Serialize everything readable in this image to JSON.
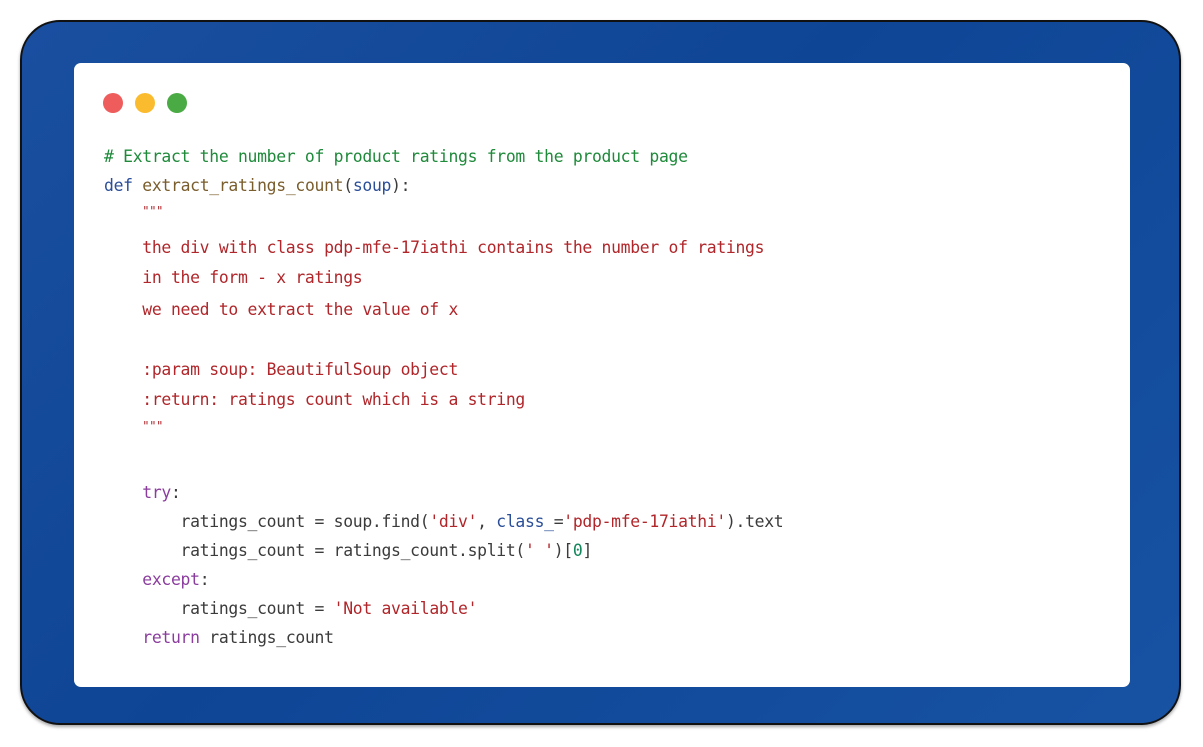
{
  "window": {
    "controls": [
      {
        "name": "close",
        "color": "#ee5c5c"
      },
      {
        "name": "minimize",
        "color": "#fbbb2f"
      },
      {
        "name": "maximize",
        "color": "#4aaa44"
      }
    ]
  },
  "code": {
    "language": "python",
    "lines": [
      {
        "tokens": [
          {
            "t": "# Extract the number of product ratings from the product page",
            "c": "comment"
          }
        ]
      },
      {
        "tokens": [
          {
            "t": "def",
            "c": "kw"
          },
          {
            "t": " ",
            "c": "plain"
          },
          {
            "t": "extract_ratings_count",
            "c": "fn"
          },
          {
            "t": "(",
            "c": "plain"
          },
          {
            "t": "soup",
            "c": "param"
          },
          {
            "t": "):",
            "c": "plain"
          }
        ]
      },
      {
        "tokens": [
          {
            "t": "    ",
            "c": "plain"
          },
          {
            "t": "\"\"\"",
            "c": "str"
          }
        ]
      },
      {
        "tokens": [
          {
            "t": "    the div with class pdp-mfe-17iathi contains the number of ratings",
            "c": "str"
          }
        ]
      },
      {
        "tokens": [
          {
            "t": "    in the form - x ratings",
            "c": "str"
          }
        ]
      },
      {
        "tokens": [
          {
            "t": "    we need to extract the value of x",
            "c": "str"
          }
        ]
      },
      {
        "tokens": []
      },
      {
        "tokens": [
          {
            "t": "    :param soup: BeautifulSoup object",
            "c": "str"
          }
        ]
      },
      {
        "tokens": [
          {
            "t": "    :return: ratings count which is a string",
            "c": "str"
          }
        ]
      },
      {
        "tokens": [
          {
            "t": "    ",
            "c": "plain"
          },
          {
            "t": "\"\"\"",
            "c": "str"
          }
        ]
      },
      {
        "tokens": []
      },
      {
        "tokens": []
      },
      {
        "tokens": [
          {
            "t": "    ",
            "c": "plain"
          },
          {
            "t": "try",
            "c": "ctrl"
          },
          {
            "t": ":",
            "c": "plain"
          }
        ]
      },
      {
        "tokens": [
          {
            "t": "        ratings_count = soup.find(",
            "c": "plain"
          },
          {
            "t": "'div'",
            "c": "str"
          },
          {
            "t": ", ",
            "c": "plain"
          },
          {
            "t": "class_",
            "c": "param"
          },
          {
            "t": "=",
            "c": "plain"
          },
          {
            "t": "'pdp-mfe-17iathi'",
            "c": "str"
          },
          {
            "t": ").text",
            "c": "plain"
          }
        ]
      },
      {
        "tokens": [
          {
            "t": "        ratings_count = ratings_count.split(",
            "c": "plain"
          },
          {
            "t": "' '",
            "c": "str"
          },
          {
            "t": ")[",
            "c": "plain"
          },
          {
            "t": "0",
            "c": "num"
          },
          {
            "t": "]",
            "c": "plain"
          }
        ]
      },
      {
        "tokens": [
          {
            "t": "    ",
            "c": "plain"
          },
          {
            "t": "except",
            "c": "ctrl"
          },
          {
            "t": ":",
            "c": "plain"
          }
        ]
      },
      {
        "tokens": [
          {
            "t": "        ratings_count = ",
            "c": "plain"
          },
          {
            "t": "'Not available'",
            "c": "str"
          }
        ]
      },
      {
        "tokens": [
          {
            "t": "    ",
            "c": "plain"
          },
          {
            "t": "return",
            "c": "ctrl"
          },
          {
            "t": " ratings_count",
            "c": "plain"
          }
        ]
      }
    ]
  }
}
